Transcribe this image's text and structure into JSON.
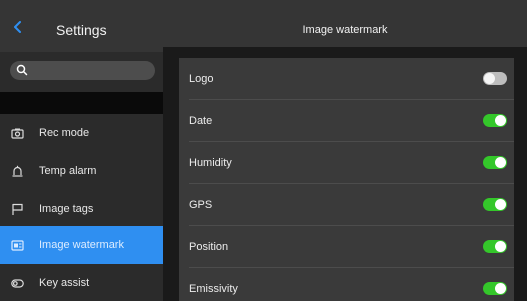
{
  "sidebar": {
    "title": "Settings",
    "search": {
      "placeholder": ""
    },
    "items": [
      {
        "label": "Rec mode",
        "icon": "camera-icon",
        "active": false
      },
      {
        "label": "Temp alarm",
        "icon": "alarm-icon",
        "active": false
      },
      {
        "label": "Image tags",
        "icon": "flag-icon",
        "active": false
      },
      {
        "label": "Image watermark",
        "icon": "watermark-icon",
        "active": true
      },
      {
        "label": "Key assist",
        "icon": "key-assist-icon",
        "active": false
      }
    ]
  },
  "content": {
    "title": "Image watermark",
    "rows": [
      {
        "label": "Logo",
        "enabled": false
      },
      {
        "label": "Date",
        "enabled": true
      },
      {
        "label": "Humidity",
        "enabled": true
      },
      {
        "label": "GPS",
        "enabled": true
      },
      {
        "label": "Position",
        "enabled": true
      },
      {
        "label": "Emissivity",
        "enabled": true
      }
    ]
  },
  "colors": {
    "accent": "#2f8ff1",
    "toggle_on": "#34c72a",
    "toggle_off": "#bdbdbd"
  }
}
